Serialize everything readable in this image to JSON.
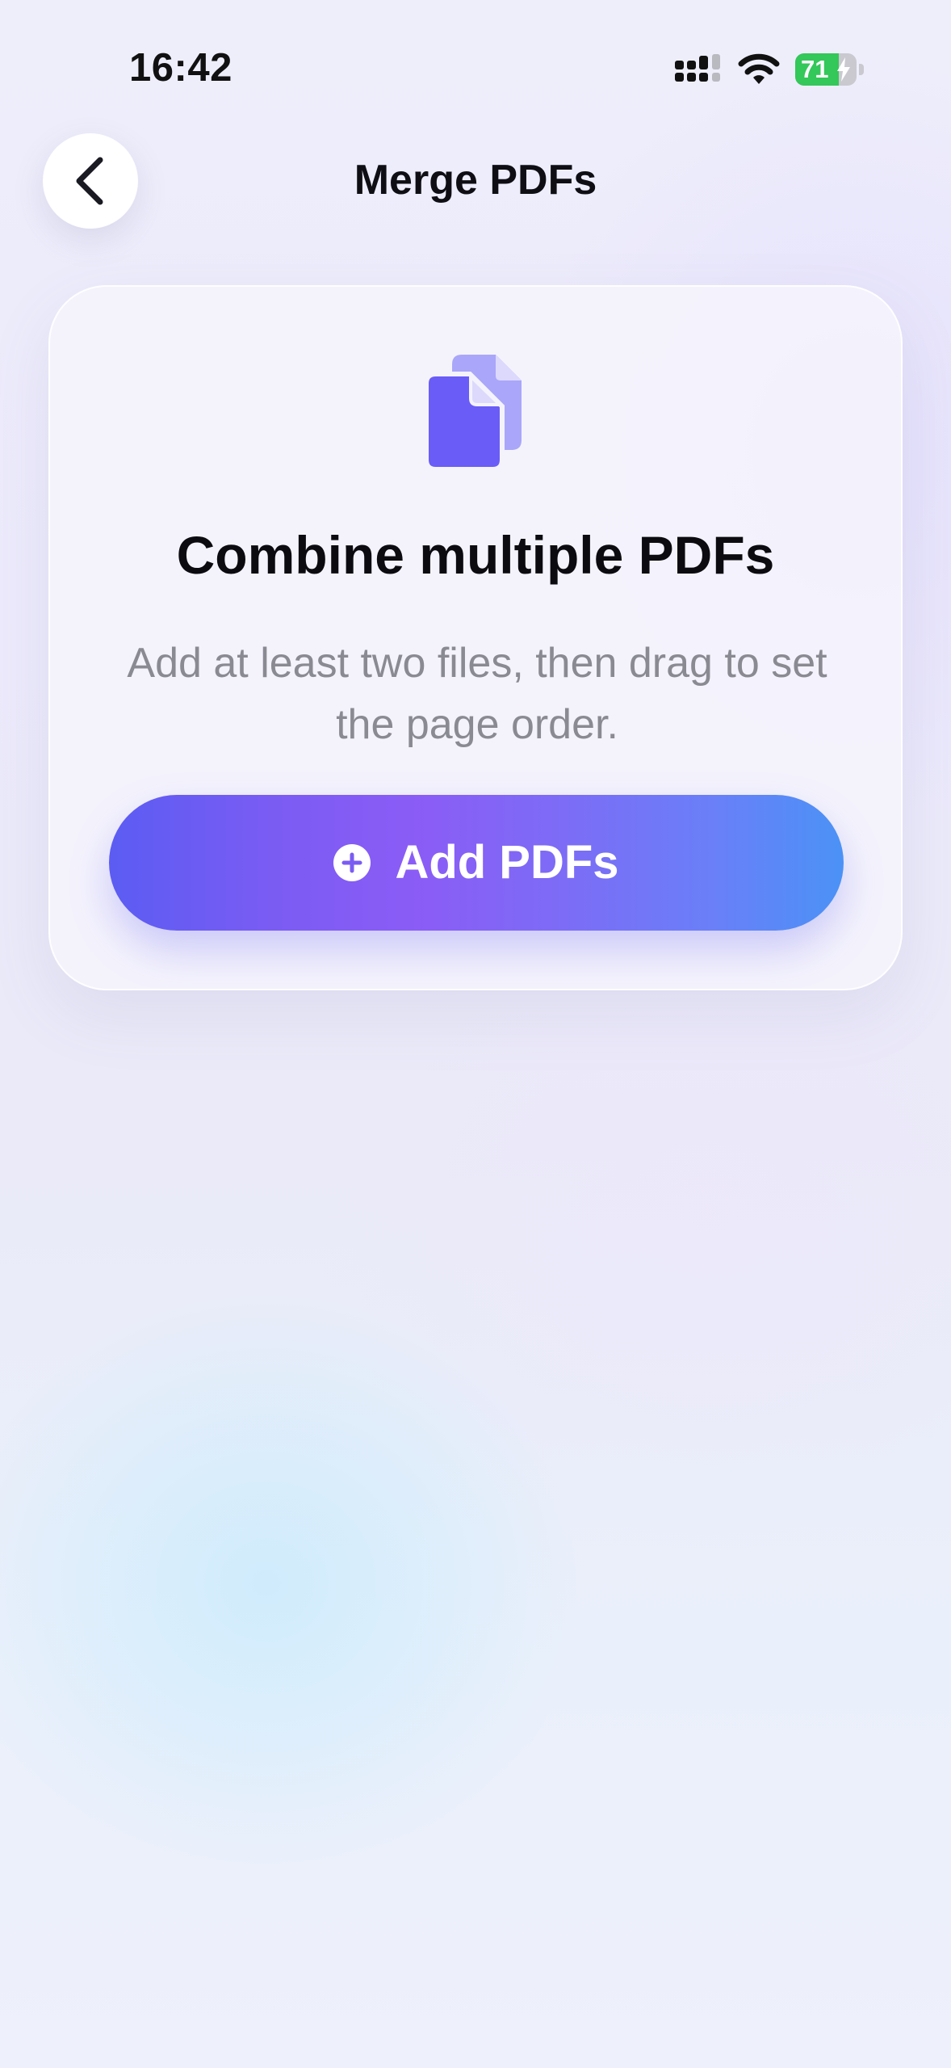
{
  "status_bar": {
    "time": "16:42",
    "battery_percent": 71,
    "battery_label": "71",
    "icons": [
      "cellular-signal-icon",
      "wifi-icon",
      "battery-icon",
      "charging-bolt-icon"
    ]
  },
  "header": {
    "back_icon": "chevron-left-icon",
    "title": "Merge PDFs"
  },
  "card": {
    "icon": "documents-icon",
    "heading": "Combine multiple PDFs",
    "subtext": "Add at least two files, then drag to set the page order.",
    "button": {
      "icon": "plus-circle-icon",
      "label": "Add PDFs"
    }
  },
  "colors": {
    "accent_start": "#5b5cf3",
    "accent_mid": "#8b5cf6",
    "accent_end": "#4b92f6",
    "battery_green": "#34c759",
    "icon_purple": "#6a5cf6"
  }
}
